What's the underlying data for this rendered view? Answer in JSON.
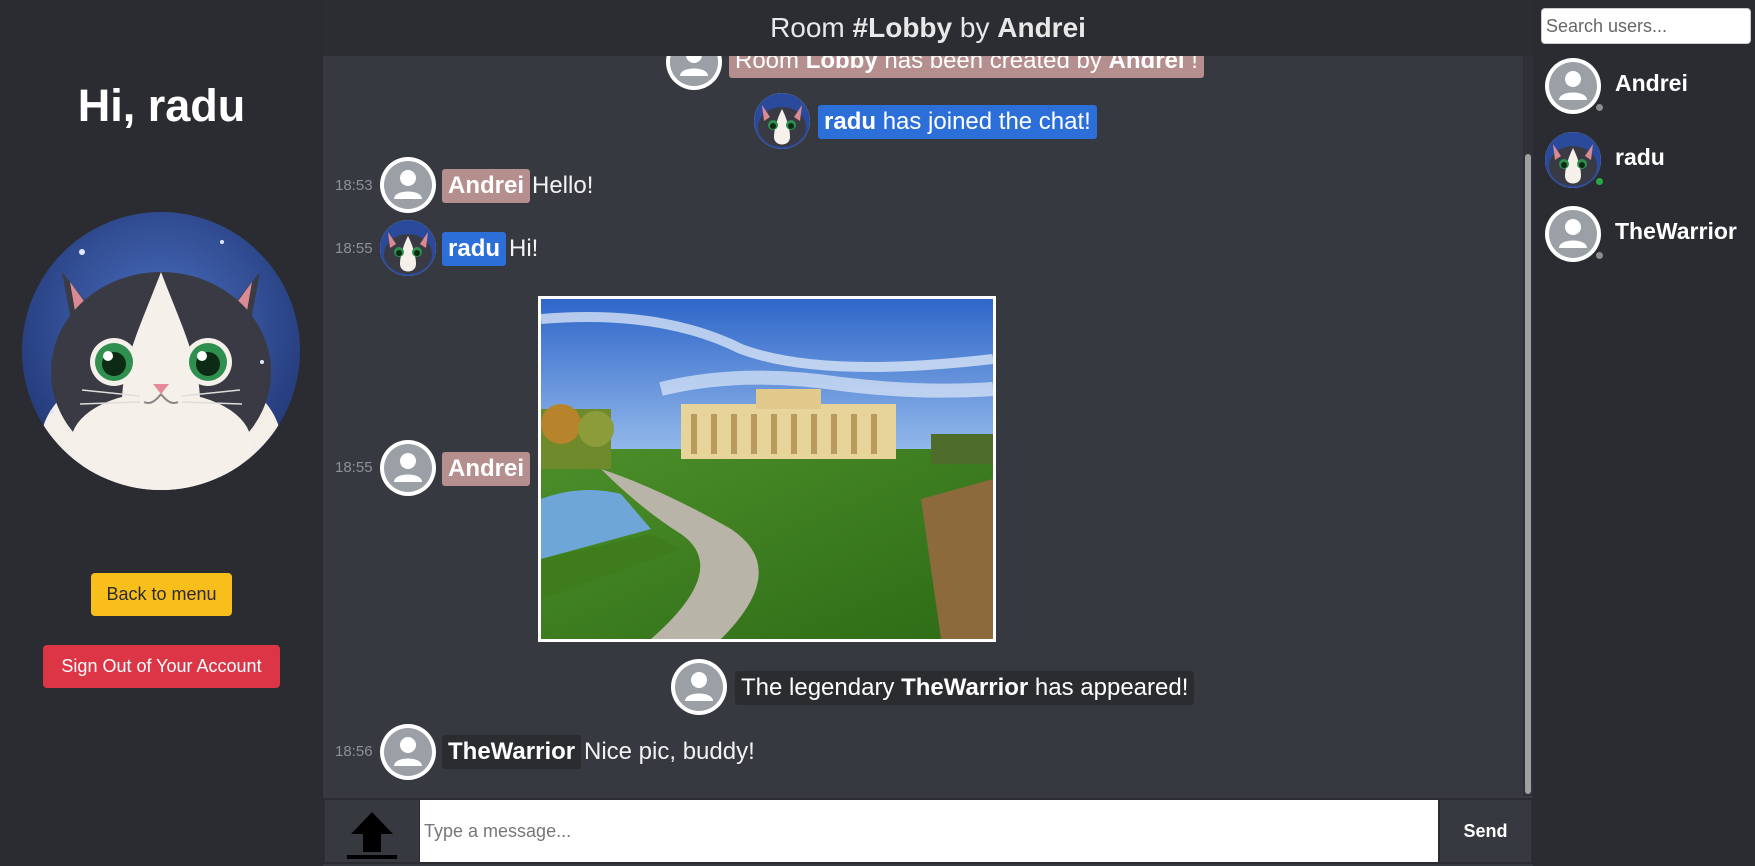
{
  "header": {
    "prefix": "Room",
    "room": "#Lobby",
    "by": "by",
    "owner": "Andrei"
  },
  "left": {
    "greeting_prefix": "Hi,",
    "username": "radu",
    "back_button": "Back to menu",
    "signout_button": "Sign Out of Your Account"
  },
  "messages": {
    "created": {
      "prefix": "Room",
      "room": "Lobby",
      "middle": "has been created by",
      "author": "Andrei",
      "suffix": "!"
    },
    "joined": {
      "user": "radu",
      "text": "has joined the chat!"
    },
    "m1": {
      "time": "18:53",
      "user": "Andrei",
      "text": "Hello!"
    },
    "m2": {
      "time": "18:55",
      "user": "radu",
      "text": "Hi!"
    },
    "m3": {
      "time": "18:55",
      "user": "Andrei"
    },
    "appeared": {
      "prefix": "The legendary",
      "user": "TheWarrior",
      "suffix": "has appeared!"
    },
    "m4": {
      "time": "18:56",
      "user": "TheWarrior",
      "text": "Nice pic, buddy!"
    }
  },
  "input": {
    "placeholder": "Type a message...",
    "send_label": "Send"
  },
  "users_panel": {
    "search_placeholder": "Search users...",
    "users": [
      {
        "name": "Andrei",
        "status": "offline"
      },
      {
        "name": "radu",
        "status": "online"
      },
      {
        "name": "TheWarrior",
        "status": "offline"
      }
    ]
  },
  "colors": {
    "andrei_tag": "#b58e8e",
    "radu_tag": "#2d6fd9",
    "warrior_tag": "#2a2c30",
    "back_button": "#f8bf1c",
    "signout_button": "#dc3545",
    "online": "#28a745",
    "offline": "#8c8c8c"
  },
  "icons": {
    "upload": "upload-arrow-icon",
    "default_avatar": "user-silhouette-icon"
  }
}
